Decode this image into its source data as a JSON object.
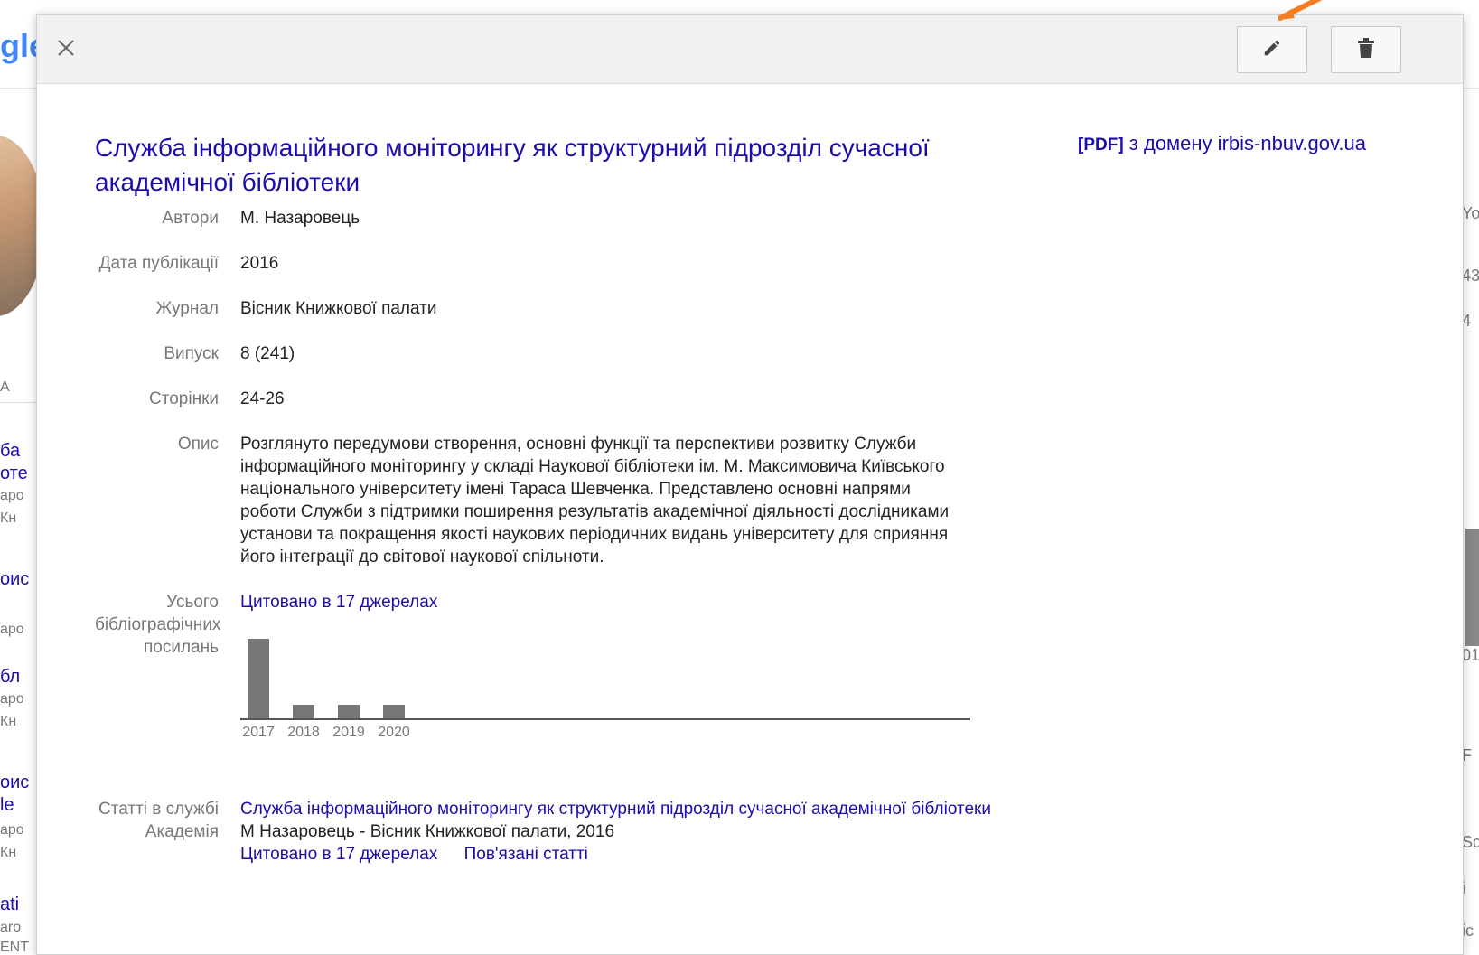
{
  "background": {
    "logo_fragment": "gle",
    "left_fragments": [
      "A",
      "ба",
      "оте",
      "аро",
      "Кн",
      "оис",
      "аро",
      "бл",
      "аро",
      "Кн",
      "оис",
      "le",
      "аро",
      "Кн",
      "ati",
      "aro",
      "ENT"
    ],
    "right_fragments": [
      "Yo",
      "43",
      "4",
      "01",
      "F",
      "Sc",
      "i",
      "ic"
    ]
  },
  "dialog": {
    "close_icon": "close-icon",
    "edit_icon": "pencil-icon",
    "delete_icon": "trash-icon",
    "accent_color": "#f57c1f"
  },
  "article": {
    "title": "Служба інформаційного моніторингу як структурний підрозділ сучасної академічної бібліотеки",
    "pdf_tag": "[PDF]",
    "pdf_text": "з домену irbis-nbuv.gov.ua",
    "fields": {
      "authors_label": "Автори",
      "authors_value": "М. Назаровець",
      "date_label": "Дата публікації",
      "date_value": "2016",
      "journal_label": "Журнал",
      "journal_value": "Вісник Книжкової палати",
      "issue_label": "Випуск",
      "issue_value": "8 (241)",
      "pages_label": "Сторінки",
      "pages_value": "24-26",
      "description_label": "Опис",
      "description_value": "Розглянуто передумови створення, основні функції та перспективи розвитку Служби інформаційного моніторингу у складі Наукової бібліотеки ім. М. Максимовича Київського національного університету імені Тараса Шевченка. Представлено основні напрями роботи Служби з підтримки поширення результатів академічної діяльності дослідниками установи та покращення якості наукових періодичних видань університету для сприяння його інтеграції до світової наукової спільноти.",
      "citations_label": "Усього бібліографічних посилань",
      "citations_value": "Цитовано в 17 джерелах",
      "scholar_label": "Статті в службі Академія"
    },
    "related": {
      "title": "Служба інформаційного моніторингу як структурний підрозділ сучасної академічної бібліотеки",
      "meta": "М Назаровець - Вісник Книжкової палати, 2016",
      "cited_link": "Цитовано в 17 джерелах",
      "related_link": "Пов'язані статті"
    }
  },
  "chart_data": {
    "type": "bar",
    "categories": [
      "2017",
      "2018",
      "2019",
      "2020"
    ],
    "values": [
      12,
      2,
      2,
      2
    ],
    "title": "",
    "xlabel": "",
    "ylabel": "",
    "ylim": [
      0,
      12
    ],
    "grid": false
  }
}
